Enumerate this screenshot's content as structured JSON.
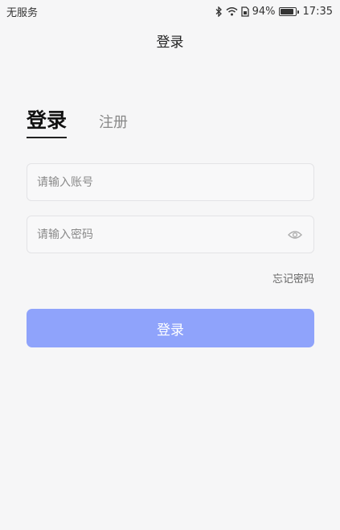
{
  "status_bar": {
    "carrier": "无服务",
    "battery_text": "94%",
    "battery_level": 0.94,
    "time": "17:35",
    "icons": [
      "bluetooth-icon",
      "wifi-icon",
      "sim-icon",
      "battery-icon"
    ]
  },
  "header": {
    "title": "登录"
  },
  "tabs": [
    {
      "label": "登录",
      "active": true
    },
    {
      "label": "注册",
      "active": false
    }
  ],
  "form": {
    "account_placeholder": "请输入账号",
    "account_value": "",
    "password_placeholder": "请输入密码",
    "password_value": "",
    "forgot_label": "忘记密码",
    "submit_label": "登录"
  },
  "colors": {
    "background": "#f6f6f7",
    "button": "#8fa3fb",
    "input_border": "#e3e3e6"
  }
}
